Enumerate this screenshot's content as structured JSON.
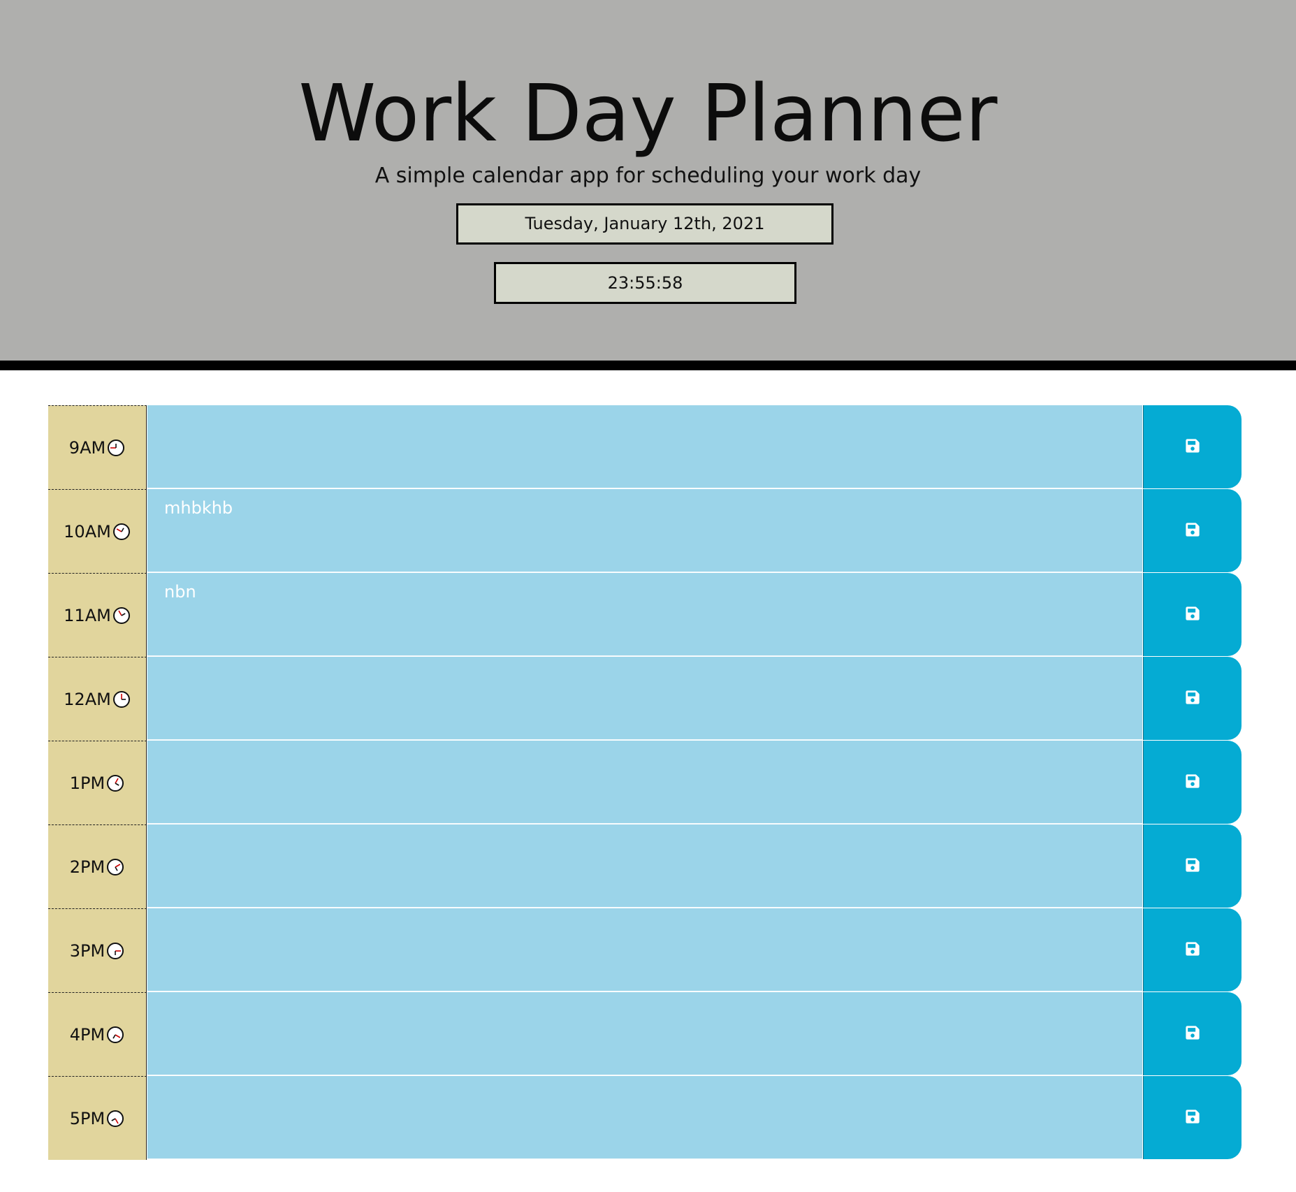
{
  "header": {
    "title": "Work Day Planner",
    "subtitle": "A simple calendar app for scheduling your work day",
    "current_date": "Tuesday, January 12th, 2021",
    "current_time": "23:55:58"
  },
  "colors": {
    "header_bg": "#afafad",
    "hour_bg": "#e1d59d",
    "textarea_future": "#9bd4e9",
    "save_button": "#05abd3"
  },
  "planner": {
    "rows": [
      {
        "hour": "9AM",
        "text": "",
        "icon": "clock-icon",
        "save_icon": "floppy-disk-icon"
      },
      {
        "hour": "10AM",
        "text": "mhbkhb",
        "icon": "clock-icon",
        "save_icon": "floppy-disk-icon"
      },
      {
        "hour": "11AM",
        "text": "nbn",
        "icon": "clock-icon",
        "save_icon": "floppy-disk-icon"
      },
      {
        "hour": "12AM",
        "text": "",
        "icon": "clock-icon",
        "save_icon": "floppy-disk-icon"
      },
      {
        "hour": "1PM",
        "text": "",
        "icon": "clock-icon",
        "save_icon": "floppy-disk-icon"
      },
      {
        "hour": "2PM",
        "text": "",
        "icon": "clock-icon",
        "save_icon": "floppy-disk-icon"
      },
      {
        "hour": "3PM",
        "text": "",
        "icon": "clock-icon",
        "save_icon": "floppy-disk-icon"
      },
      {
        "hour": "4PM",
        "text": "",
        "icon": "clock-icon",
        "save_icon": "floppy-disk-icon"
      },
      {
        "hour": "5PM",
        "text": "",
        "icon": "clock-icon",
        "save_icon": "floppy-disk-icon"
      }
    ]
  }
}
